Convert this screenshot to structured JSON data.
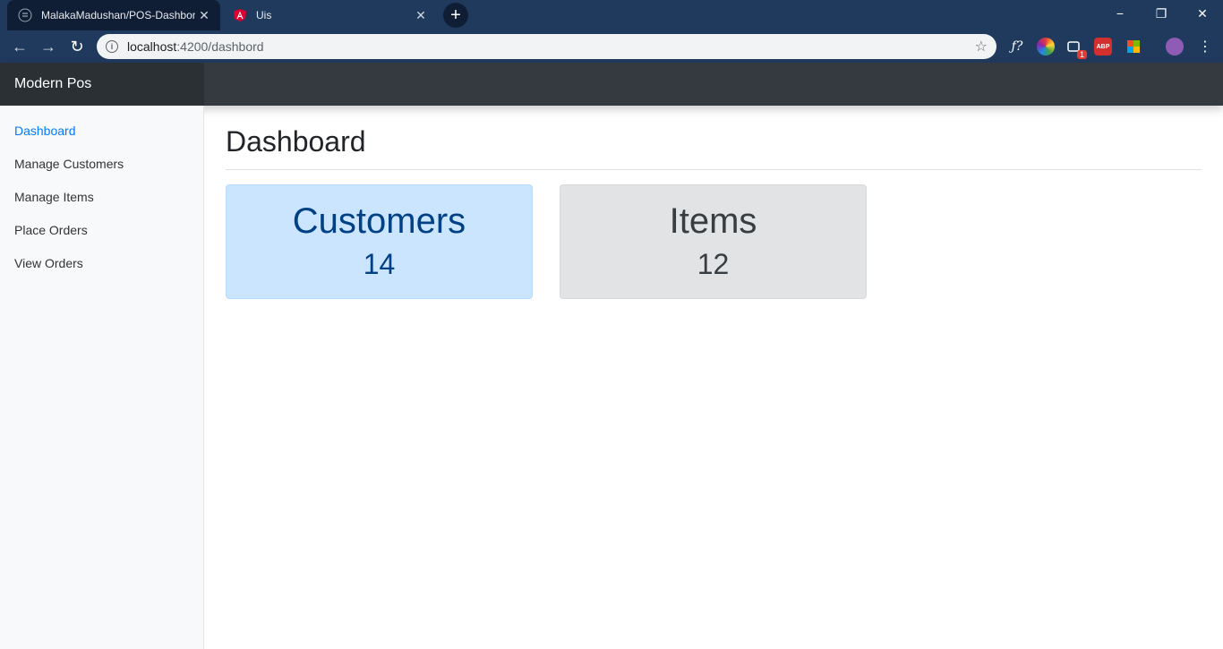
{
  "browser": {
    "tabs": [
      {
        "title": "MalakaMadushan/POS-Dashbord",
        "favicon": "github-icon",
        "active": true
      },
      {
        "title": "Uis",
        "favicon": "angular-icon",
        "active": false
      }
    ],
    "new_tab": "+",
    "address": {
      "host": "localhost",
      "path": ":4200/dashbord"
    },
    "window_controls": [
      "−",
      "❐",
      "✕"
    ]
  },
  "app": {
    "brand": "Modern Pos",
    "sidebar": {
      "items": [
        {
          "label": "Dashboard",
          "active": true
        },
        {
          "label": "Manage Customers",
          "active": false
        },
        {
          "label": "Manage Items",
          "active": false
        },
        {
          "label": "Place Orders",
          "active": false
        },
        {
          "label": "View Orders",
          "active": false
        }
      ]
    },
    "main": {
      "title": "Dashboard",
      "cards": [
        {
          "label": "Customers",
          "count": "14",
          "color": "#cce5ff"
        },
        {
          "label": "Items",
          "count": "12",
          "color": "#e2e3e5"
        }
      ]
    }
  },
  "extensions": {
    "badge_count": "1",
    "abp_label": "ABP"
  }
}
